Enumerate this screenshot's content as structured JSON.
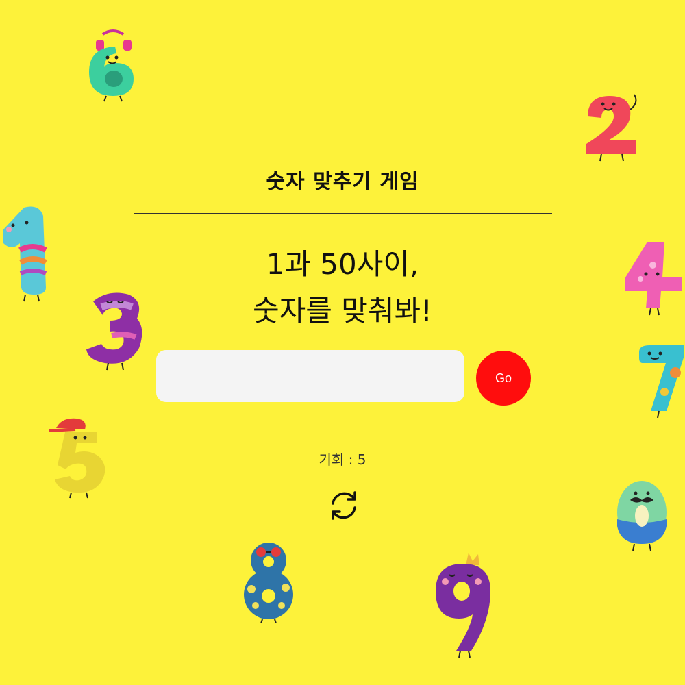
{
  "game": {
    "title": "숫자 맞추기 게임",
    "prompt_line1": "1과 50사이,",
    "prompt_line2": "숫자를 맞춰봐!",
    "input_value": "",
    "go_label": "Go",
    "chances_label": "기회 : 5",
    "reset_icon": "refresh-icon"
  },
  "colors": {
    "background": "#fdf23a",
    "go_button": "#ff0d0d",
    "input_background": "#f4f4f4"
  },
  "decorations": [
    {
      "name": "number-six-character",
      "digit": "6",
      "color": "#3ccf9e"
    },
    {
      "name": "number-two-character",
      "digit": "2",
      "color": "#f0475a"
    },
    {
      "name": "number-one-character",
      "digit": "1",
      "color": "#5ac8d8"
    },
    {
      "name": "number-four-character",
      "digit": "4",
      "color": "#ef5fb4"
    },
    {
      "name": "number-three-character",
      "digit": "3",
      "color": "#8e2fa5"
    },
    {
      "name": "number-seven-character",
      "digit": "7",
      "color": "#39c0d0"
    },
    {
      "name": "number-five-character",
      "digit": "5",
      "color": "#e8d533"
    },
    {
      "name": "number-zero-character",
      "digit": "0",
      "color": "#7fd6a3"
    },
    {
      "name": "number-eight-character",
      "digit": "8",
      "color": "#2e74a8"
    },
    {
      "name": "number-nine-character",
      "digit": "9",
      "color": "#7a2ea0"
    }
  ]
}
